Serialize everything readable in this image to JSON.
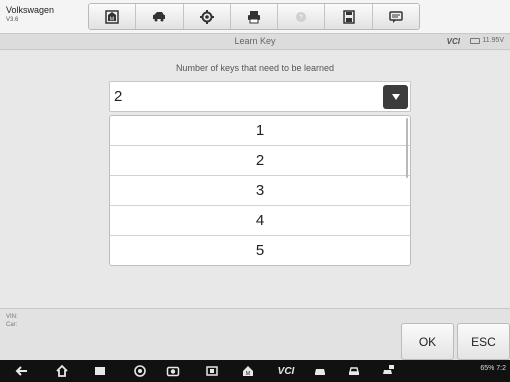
{
  "header": {
    "brand": "Volkswagen",
    "version": "V3.6",
    "toolbar": [
      {
        "name": "home-icon"
      },
      {
        "name": "vehicle-swap-icon"
      },
      {
        "name": "settings-icon"
      },
      {
        "name": "print-icon"
      },
      {
        "name": "help-icon"
      },
      {
        "name": "save-icon"
      },
      {
        "name": "data-logging-icon"
      }
    ]
  },
  "titlebar": {
    "title": "Learn Key",
    "vci": "VCI",
    "voltage": "11.95V"
  },
  "main": {
    "prompt": "Number of keys that need to be learned",
    "selected": "2",
    "options": [
      "1",
      "2",
      "3",
      "4",
      "5"
    ]
  },
  "footer": {
    "vin_label": "VIN:",
    "car_label": "Car:",
    "ok_label": "OK",
    "esc_label": "ESC"
  },
  "navbar": {
    "vci_label": "VCI",
    "status_text": "65% 7:2"
  }
}
